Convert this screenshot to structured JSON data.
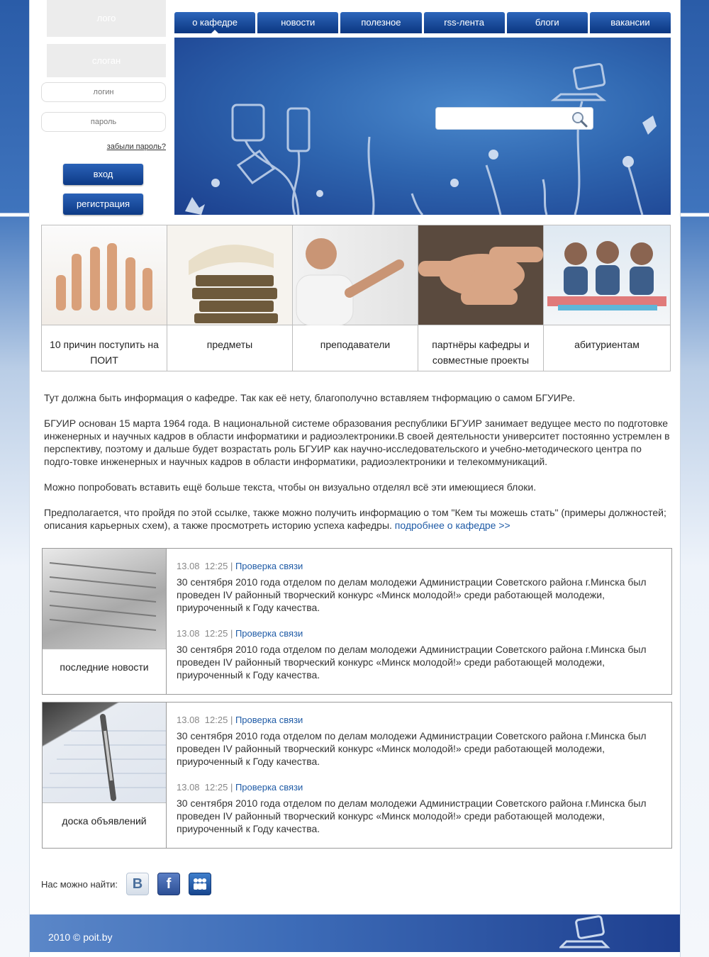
{
  "sidebar": {
    "logo": "лого",
    "slogan": "слоган",
    "login_placeholder": "логин",
    "password_placeholder": "пароль",
    "forgot": "забыли пароль?",
    "enter_label": "вход",
    "register_label": "регистрация"
  },
  "nav": {
    "tabs": [
      "о кафедре",
      "новости",
      "полезное",
      "rss-лента",
      "блоги",
      "вакансии"
    ]
  },
  "cards": [
    {
      "label": "10 причин поступить на ПОИТ"
    },
    {
      "label": "предметы"
    },
    {
      "label": "преподаватели"
    },
    {
      "label": "партнёры кафедры и совместные проекты"
    },
    {
      "label": "абитуриентам"
    }
  ],
  "about": {
    "p1": "Тут должна быть информация о кафедре. Так как её нету, благополучно вставляем тнформацию о самом БГУИРе.",
    "p2": "БГУИР основан 15 марта 1964 года. В национальной системе образования республики БГУИР занимает ведущее место по подготовке инженерных и научных кадров в области информатики и радиоэлектроники.В своей деятельности университет постоянно устремлен в перспективу, поэтому и дальше будет возрастать роль БГУИР как научно-исследовательского и учебно-методического центра по подго-товке инженерных и научных кадров в области информатики, радиоэлектроники и телекоммуникаций.",
    "p3": "Можно попробовать вставить ещё больше текста, чтобы он визуально отделял всё эти имеющиеся блоки.",
    "p4": "Предполагается, что пройдя по этой ссылке, также можно получить информацию о том \"Кем ты можешь стать\" (примеры должностей; описания карьерных схем), а также просмотреть историю успеха кафедры.",
    "more_link": "подробнее о кафедре >>"
  },
  "news_block": {
    "label": "последние новости",
    "items": [
      {
        "date": "13.08",
        "time": "12:25",
        "title": "Проверка связи",
        "text": "30 сентября 2010 года отделом по делам молодежи Администрации Советского района г.Минска был проведен IV районный творческий конкурс «Минск молодой!» среди работающей молодежи, приуроченный к Году качества."
      },
      {
        "date": "13.08",
        "time": "12:25",
        "title": "Проверка связи",
        "text": "30 сентября 2010 года отделом по делам молодежи Администрации Советского района г.Минска был проведен IV районный творческий конкурс «Минск молодой!» среди работающей молодежи, приуроченный к Году качества."
      }
    ]
  },
  "ads_block": {
    "label": "доска объявлений",
    "items": [
      {
        "date": "13.08",
        "time": "12:25",
        "title": "Проверка связи",
        "text": "30 сентября 2010 года отделом по делам молодежи Администрации Советского района г.Минска был проведен IV районный творческий конкурс «Минск молодой!» среди работающей молодежи, приуроченный к Году качества."
      },
      {
        "date": "13.08",
        "time": "12:25",
        "title": "Проверка связи",
        "text": "30 сентября 2010 года отделом по делам молодежи Администрации Советского района г.Минска был проведен IV районный творческий конкурс «Минск молодой!» среди работающей молодежи, приуроченный к Году качества."
      }
    ]
  },
  "social": {
    "label": "Нас можно найти:",
    "icons": [
      "vkontakte-icon",
      "facebook-icon",
      "myspace-icon"
    ],
    "vk_glyph": "В",
    "fb_glyph": "f"
  },
  "footer": {
    "copyright": "2010 © poit.by"
  }
}
